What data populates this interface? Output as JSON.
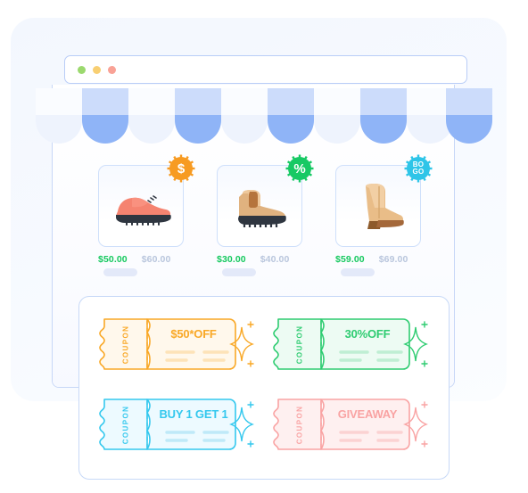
{
  "scene": {
    "title": "Online store coupons and discounted shoes illustration",
    "palette": {
      "backdrop": "#f3f7fe",
      "panel_border": "#c7d7f7",
      "awning_light": "#eef3fd",
      "awning_blue": "#8fb4f7",
      "price_new": "#16c95f",
      "price_old": "#b9c6dd",
      "coupon_orange": "#f9a826",
      "coupon_green": "#2ecc71",
      "coupon_cyan": "#34c8ee",
      "coupon_pink": "#f9a3a3"
    }
  },
  "browser": {
    "window_controls": [
      {
        "name": "minimize-dot",
        "color": "#9bd96e"
      },
      {
        "name": "maximize-dot",
        "color": "#f8cf72"
      },
      {
        "name": "close-dot",
        "color": "#f9a296"
      }
    ]
  },
  "awning": {
    "scallop_count": 11,
    "pattern": [
      "light",
      "blue",
      "light",
      "blue",
      "light",
      "blue",
      "light",
      "blue",
      "light",
      "blue",
      "light"
    ]
  },
  "products": [
    {
      "name": "pink-derby-shoe",
      "icon": "shoe-derby-icon",
      "price_new": "$50.00",
      "price_old": "$60.00",
      "badge": {
        "label": "$",
        "icon": "dollar-badge-icon",
        "color": "#f79b22",
        "style": "big"
      }
    },
    {
      "name": "tan-chelsea-boot",
      "icon": "boot-chelsea-icon",
      "price_new": "$30.00",
      "price_old": "$40.00",
      "badge": {
        "label": "%",
        "icon": "percent-badge-icon",
        "color": "#17c964",
        "style": "big"
      }
    },
    {
      "name": "tan-heeled-ankle-boot",
      "icon": "boot-heeled-icon",
      "price_new": "$59.00",
      "price_old": "$69.00",
      "badge": {
        "label_line1": "BO",
        "label_line2": "GO",
        "icon": "bogo-badge-icon",
        "color": "#2ec5e8",
        "style": "bogo"
      }
    }
  ],
  "coupons": [
    {
      "name": "coupon-50-off",
      "side_label": "COUPON",
      "text": "$50*OFF",
      "color": "#f9a826",
      "fill": "#fff8ec",
      "line": "#fde3b8"
    },
    {
      "name": "coupon-30-percent",
      "side_label": "COUPON",
      "text": "30%OFF",
      "color": "#2ecc71",
      "fill": "#edfbf3",
      "line": "#bfeed3"
    },
    {
      "name": "coupon-bogo",
      "side_label": "COUPON",
      "text": "BUY 1 GET 1",
      "color": "#34c8ee",
      "fill": "#edfaff",
      "line": "#bfe9f8"
    },
    {
      "name": "coupon-giveaway",
      "side_label": "COUPON",
      "text": "GIVEAWAY",
      "color": "#f9a3a3",
      "fill": "#fef0f0",
      "line": "#fbd2d2"
    }
  ]
}
